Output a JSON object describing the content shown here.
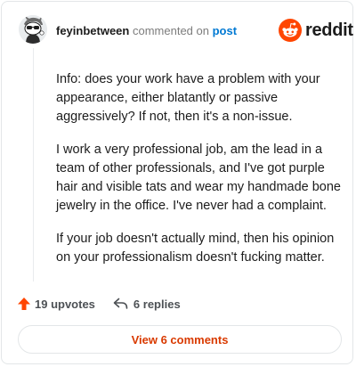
{
  "comment": {
    "username": "feyinbetween",
    "action_text": "commented on",
    "post_link": "post",
    "paragraphs": [
      "Info: does your work have a problem with your appearance, either blatantly or passive aggressively? If not, then it's a non-issue.",
      "I work a very professional job, am the lead in a team of other professionals, and I've got purple hair and visible tats and wear my handmade bone jewelry in the office. I've never had a complaint.",
      "If your job doesn't actually mind, then his opinion on your professionalism doesn't fucking matter."
    ]
  },
  "brand": {
    "name": "reddit",
    "logo_icon": "reddit-snoo-icon",
    "accent_color": "#ff4500"
  },
  "actions": {
    "upvotes_label": "19 upvotes",
    "replies_label": "6 replies",
    "upvote_icon": "upvote-arrow-icon",
    "reply_icon": "reply-arrow-icon",
    "upvote_color": "#ff4500"
  },
  "footer": {
    "view_comments_label": "View 6 comments",
    "link_color": "#d93a00"
  }
}
